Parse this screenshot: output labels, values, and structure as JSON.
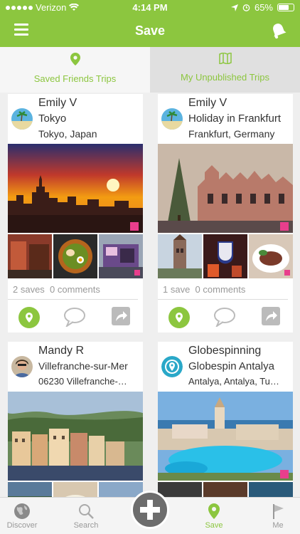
{
  "status": {
    "carrier": "Verizon",
    "time": "4:14 PM",
    "battery": "65%"
  },
  "nav": {
    "title": "Save"
  },
  "tabs": [
    {
      "label": "Saved Friends Trips",
      "icon": "map-pin-icon"
    },
    {
      "label": "My Unpublished Trips",
      "icon": "folded-map-icon"
    }
  ],
  "cards": [
    {
      "user": "Emily V",
      "trip": "Tokyo",
      "place": "Tokyo, Japan",
      "saves": "2 saves",
      "comments": "0 comments"
    },
    {
      "user": "Emily V",
      "trip": "Holiday in Frankfurt",
      "place": "Frankfurt, Germany",
      "saves": "1 save",
      "comments": "0 comments"
    },
    {
      "user": "Mandy R",
      "trip": "Villefranche-sur-Mer",
      "place": "06230 Villefranche-…"
    },
    {
      "user": "Globespinning",
      "trip": "Globespin Antalya",
      "place": "Antalya, Antalya, Tu…"
    }
  ],
  "bottom_nav": [
    {
      "label": "Discover",
      "icon": "globe-icon"
    },
    {
      "label": "Search",
      "icon": "magnifier-icon"
    },
    {
      "label": "Save",
      "icon": "map-pin-icon",
      "active": true
    },
    {
      "label": "Me",
      "icon": "flag-icon"
    }
  ],
  "colors": {
    "brand": "#8cc63f",
    "tab_inactive_bg": "#e0e0e0",
    "plus_button": "#6d6d6d"
  }
}
